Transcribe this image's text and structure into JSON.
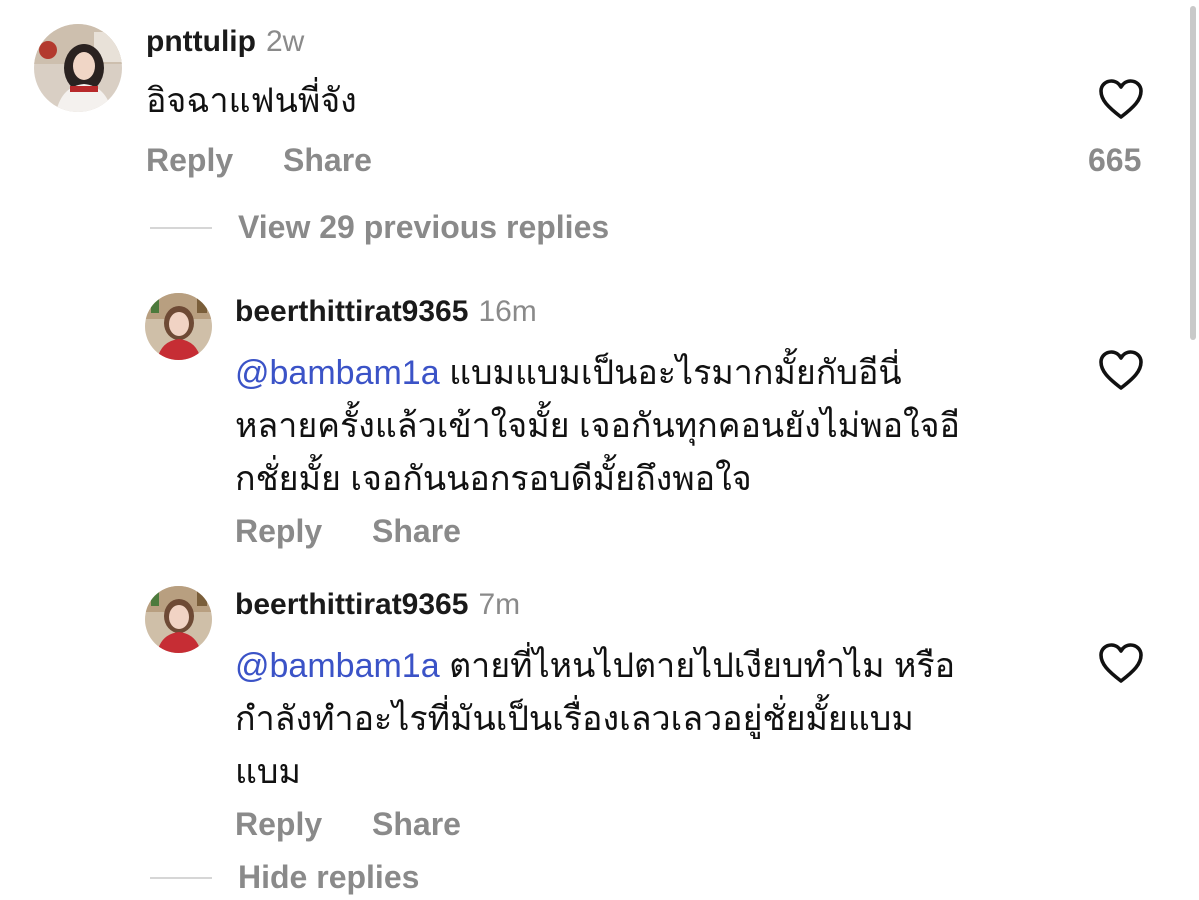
{
  "comment": {
    "username": "pnttulip",
    "time": "2w",
    "text": "อิจฉาแฟนพี่จัง",
    "like_count": "665",
    "reply_label": "Reply",
    "share_label": "Share"
  },
  "view_previous_replies": "View 29 previous replies",
  "replies": [
    {
      "username": "beerthittirat9365",
      "time": "16m",
      "mention": "@bambam1a",
      "text_lines": [
        "แบมแบมเป็นอะไรมากมั้ยกับอีนี่",
        "หลายครั้งแล้วเข้าใจมั้ย เจอกันทุกคอนยังไม่พอใจอี",
        "กชั่ยมั้ย เจอกันนอกรอบดีมั้ยถึงพอใจ"
      ],
      "reply_label": "Reply",
      "share_label": "Share"
    },
    {
      "username": "beerthittirat9365",
      "time": "7m",
      "mention": "@bambam1a",
      "text_lines": [
        "ตายที่ไหนไปตายไปเงียบทำไม หรือ",
        "กำลังทำอะไรที่มันเป็นเรื่องเลวเลวอยู่ชั่ยมั้ยแบม",
        "แบม"
      ],
      "reply_label": "Reply",
      "share_label": "Share"
    }
  ],
  "hide_replies": "Hide replies",
  "icons": {
    "heart": "heart-outline-icon",
    "avatar": "profile-photo"
  },
  "colors": {
    "mention": "#3b53c7",
    "secondary_text": "#8a8a8a",
    "primary_text": "#111111"
  }
}
